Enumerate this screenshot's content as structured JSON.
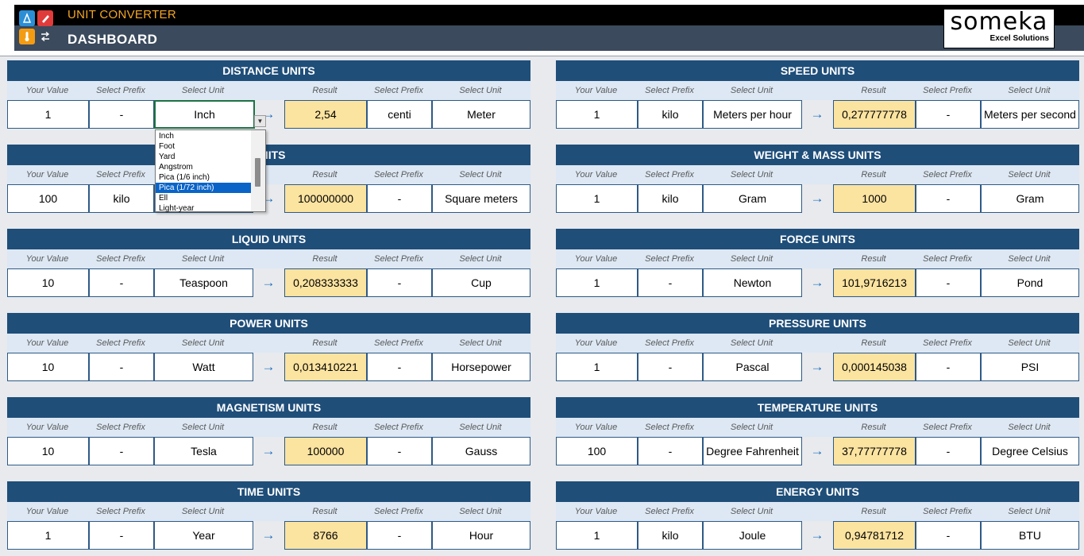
{
  "header": {
    "app_title": "UNIT CONVERTER",
    "page_title": "DASHBOARD",
    "brand_name": "someka",
    "brand_sub": "Excel Solutions"
  },
  "columns": {
    "your_value": "Your Value",
    "select_prefix": "Select Prefix",
    "select_unit": "Select Unit",
    "result": "Result"
  },
  "panels": [
    {
      "title": "DISTANCE UNITS",
      "value": "1",
      "prefix_in": "-",
      "unit_in": "Inch",
      "result": "2,54",
      "prefix_out": "centi",
      "unit_out": "Meter"
    },
    {
      "title": "UNITS",
      "value": "100",
      "prefix_in": "kilo",
      "unit_in": "",
      "result": "100000000",
      "prefix_out": "-",
      "unit_out": "Square meters"
    },
    {
      "title": "LIQUID UNITS",
      "value": "10",
      "prefix_in": "-",
      "unit_in": "Teaspoon",
      "result": "0,208333333",
      "prefix_out": "-",
      "unit_out": "Cup"
    },
    {
      "title": "POWER UNITS",
      "value": "10",
      "prefix_in": "-",
      "unit_in": "Watt",
      "result": "0,013410221",
      "prefix_out": "-",
      "unit_out": "Horsepower"
    },
    {
      "title": "MAGNETISM UNITS",
      "value": "10",
      "prefix_in": "-",
      "unit_in": "Tesla",
      "result": "100000",
      "prefix_out": "-",
      "unit_out": "Gauss"
    },
    {
      "title": "TIME UNITS",
      "value": "1",
      "prefix_in": "-",
      "unit_in": "Year",
      "result": "8766",
      "prefix_out": "-",
      "unit_out": "Hour"
    },
    {
      "title": "SPEED UNITS",
      "value": "1",
      "prefix_in": "kilo",
      "unit_in": "Meters per hour",
      "result": "0,277777778",
      "prefix_out": "-",
      "unit_out": "Meters per second"
    },
    {
      "title": "WEIGHT & MASS UNITS",
      "value": "1",
      "prefix_in": "kilo",
      "unit_in": "Gram",
      "result": "1000",
      "prefix_out": "-",
      "unit_out": "Gram"
    },
    {
      "title": "FORCE UNITS",
      "value": "1",
      "prefix_in": "-",
      "unit_in": "Newton",
      "result": "101,9716213",
      "prefix_out": "-",
      "unit_out": "Pond"
    },
    {
      "title": "PRESSURE UNITS",
      "value": "1",
      "prefix_in": "-",
      "unit_in": "Pascal",
      "result": "0,000145038",
      "prefix_out": "-",
      "unit_out": "PSI"
    },
    {
      "title": "TEMPERATURE UNITS",
      "value": "100",
      "prefix_in": "-",
      "unit_in": "Degree Fahrenheit",
      "result": "37,77777778",
      "prefix_out": "-",
      "unit_out": "Degree Celsius"
    },
    {
      "title": "ENERGY UNITS",
      "value": "1",
      "prefix_in": "kilo",
      "unit_in": "Joule",
      "result": "0,94781712",
      "prefix_out": "-",
      "unit_out": "BTU"
    }
  ],
  "dropdown": {
    "options": [
      "Inch",
      "Foot",
      "Yard",
      "Angstrom",
      "Pica (1/6 inch)",
      "Pica (1/72 inch)",
      "Ell",
      "Light-year"
    ],
    "highlighted": 5
  },
  "icons": {
    "arrow": "→",
    "dropdown": "▼",
    "colors": {
      "blue": "#2b8fd6",
      "red": "#e03b3b",
      "orange": "#f39c12",
      "slate": "#3b4a5c"
    }
  }
}
